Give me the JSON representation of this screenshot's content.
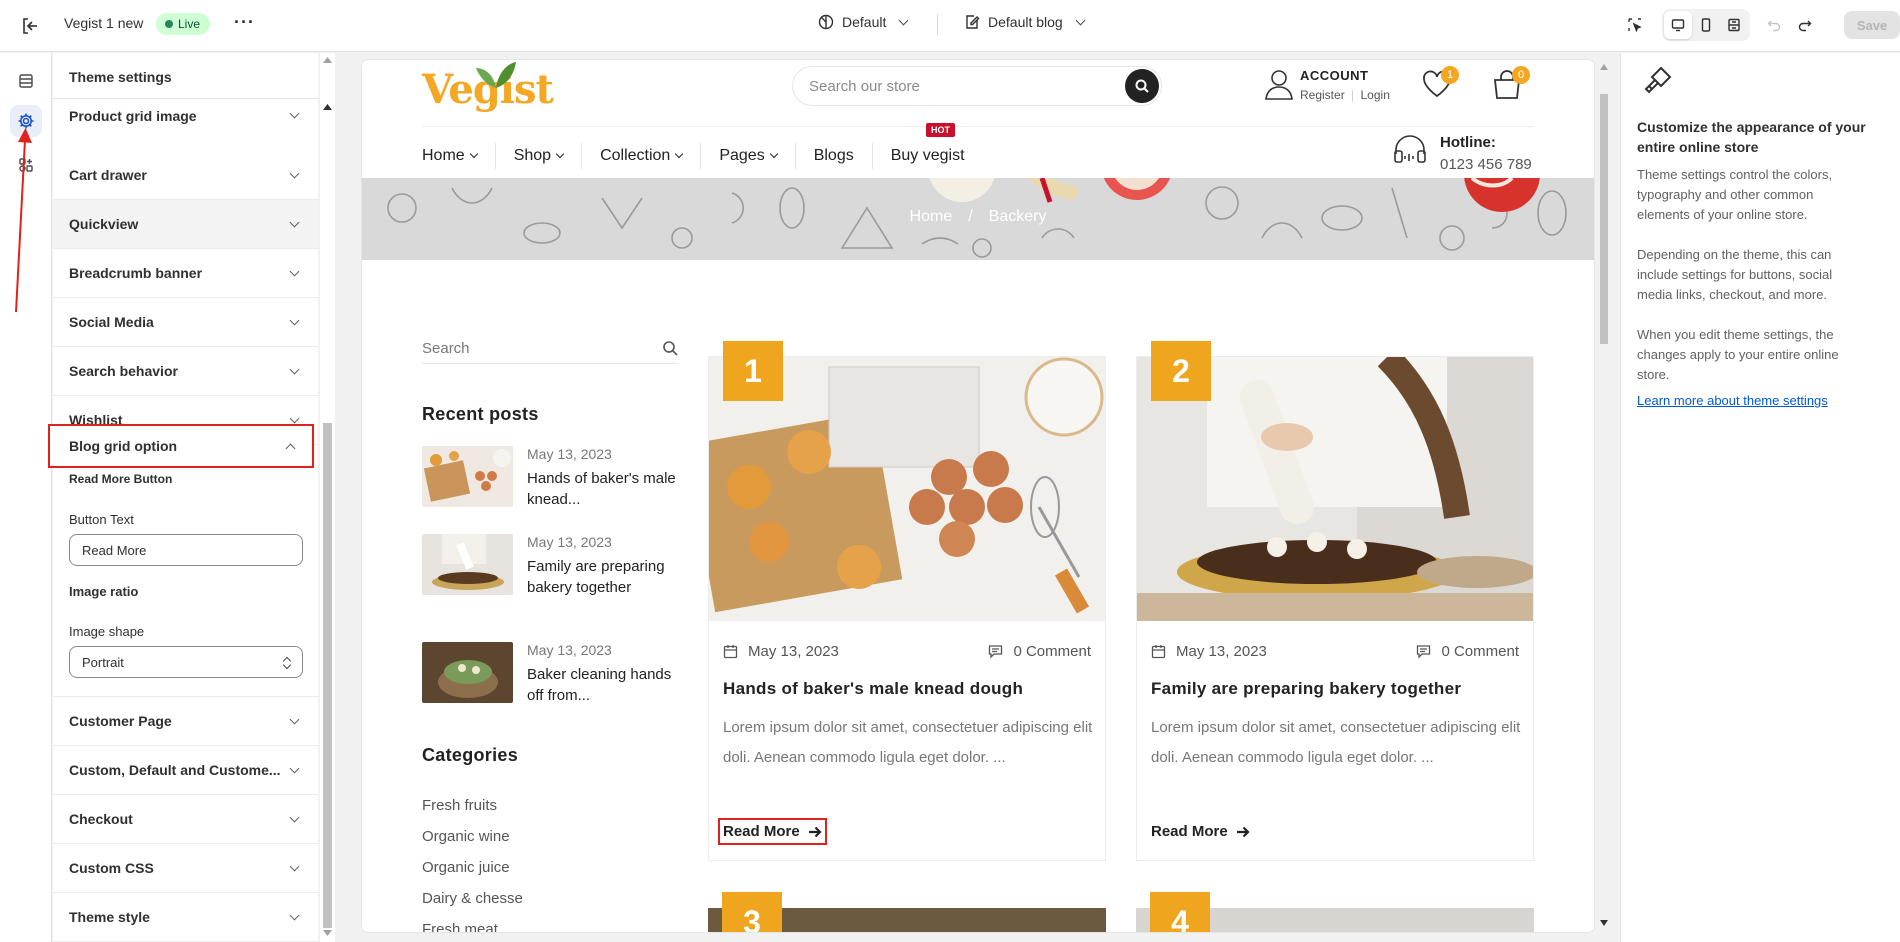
{
  "topbar": {
    "store_name": "Vegist 1 new",
    "status": "Live",
    "theme_select": "Default",
    "template_select": "Default blog",
    "save_label": "Save"
  },
  "panel": {
    "title": "Theme settings",
    "sections_top": [
      "Product grid image",
      "Cart drawer",
      "Quickview",
      "Breadcrumb banner",
      "Social Media",
      "Search behavior",
      "Wishlist"
    ],
    "open_section": "Blog grid option",
    "read_more_heading": "Read More Button",
    "button_text_label": "Button Text",
    "button_text_value": "Read More",
    "image_ratio_heading": "Image ratio",
    "image_shape_label": "Image shape",
    "image_shape_value": "Portrait",
    "sections_bottom": [
      "Customer Page",
      "Custom, Default and Custome...",
      "Checkout",
      "Custom CSS",
      "Theme style"
    ]
  },
  "store": {
    "logo": "Vegist",
    "search_placeholder": "Search our store",
    "account_title": "ACCOUNT",
    "account_register": "Register",
    "account_login": "Login",
    "wishlist_count": "1",
    "cart_count": "0",
    "nav": [
      "Home",
      "Shop",
      "Collection",
      "Pages",
      "Blogs",
      "Buy vegist"
    ],
    "hot_badge": "HOT",
    "hotline_title": "Hotline:",
    "hotline_number": "0123 456 789",
    "breadcrumb_home": "Home",
    "breadcrumb_sep": "/",
    "breadcrumb_current": "Backery",
    "sidebar_search_placeholder": "Search",
    "recent_posts_heading": "Recent posts",
    "recent_posts": [
      {
        "date": "May 13, 2023",
        "title": "Hands of baker's male knead..."
      },
      {
        "date": "May 13, 2023",
        "title": "Family are preparing bakery together"
      },
      {
        "date": "May 13, 2023",
        "title": "Baker cleaning hands off from..."
      }
    ],
    "categories_heading": "Categories",
    "categories": [
      "Fresh fruits",
      "Organic wine",
      "Organic juice",
      "Dairy & chesse",
      "Fresh meat"
    ],
    "posts": [
      {
        "num": "1",
        "date": "May 13, 2023",
        "comments": "0 Comment",
        "title": "Hands of baker's male knead dough",
        "excerpt": "Lorem ipsum dolor sit amet, consectetuer adipiscing elit doli. Aenean commodo ligula eget dolor. ...",
        "read_more": "Read More"
      },
      {
        "num": "2",
        "date": "May 13, 2023",
        "comments": "0 Comment",
        "title": "Family are preparing bakery together",
        "excerpt": "Lorem ipsum dolor sit amet, consectetuer adipiscing elit doli. Aenean commodo ligula eget dolor. ...",
        "read_more": "Read More"
      }
    ],
    "post_numbers_lower": [
      "3",
      "4"
    ]
  },
  "info": {
    "heading": "Customize the appearance of your entire online store",
    "p1": "Theme settings control the colors, typography and other common elements of your online store.",
    "p2": "Depending on the theme, this can include settings for buttons, social media links, checkout, and more.",
    "p3": "When you edit theme settings, the changes apply to your entire online store.",
    "link": "Learn more about theme settings"
  },
  "colors": {
    "accent": "#f5a623",
    "highlight": "#e0211d",
    "live": "#29845a",
    "link": "#005bd3"
  }
}
